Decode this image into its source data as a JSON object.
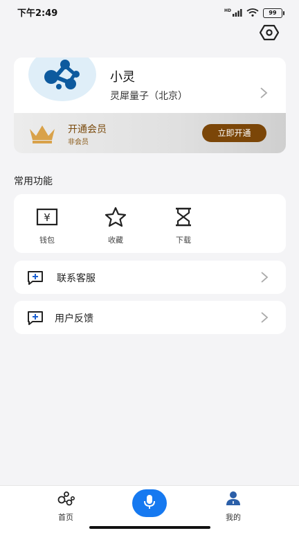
{
  "status_bar": {
    "time": "下午2:49",
    "signal_tag": "HD",
    "battery": "99"
  },
  "profile": {
    "name": "小灵",
    "organization": "灵犀量子（北京）"
  },
  "vip": {
    "title": "开通会员",
    "status": "非会员",
    "button_label": "立即开通",
    "accent_color": "#7b4608"
  },
  "functions": {
    "section_title": "常用功能",
    "items": [
      {
        "label": "钱包",
        "icon": "wallet-icon"
      },
      {
        "label": "收藏",
        "icon": "star-icon"
      },
      {
        "label": "下载",
        "icon": "hourglass-icon"
      }
    ]
  },
  "menu": {
    "items": [
      {
        "label": "联系客服",
        "icon": "chat-plus-icon"
      },
      {
        "label": "用户反馈",
        "icon": "chat-plus-icon"
      }
    ]
  },
  "tabbar": {
    "items": [
      {
        "label": "首页",
        "icon": "home-molecule-icon",
        "active": false
      },
      {
        "label": "",
        "icon": "microphone-icon",
        "active": false
      },
      {
        "label": "我的",
        "icon": "person-icon",
        "active": true
      }
    ],
    "accent_color": "#1679f0"
  }
}
